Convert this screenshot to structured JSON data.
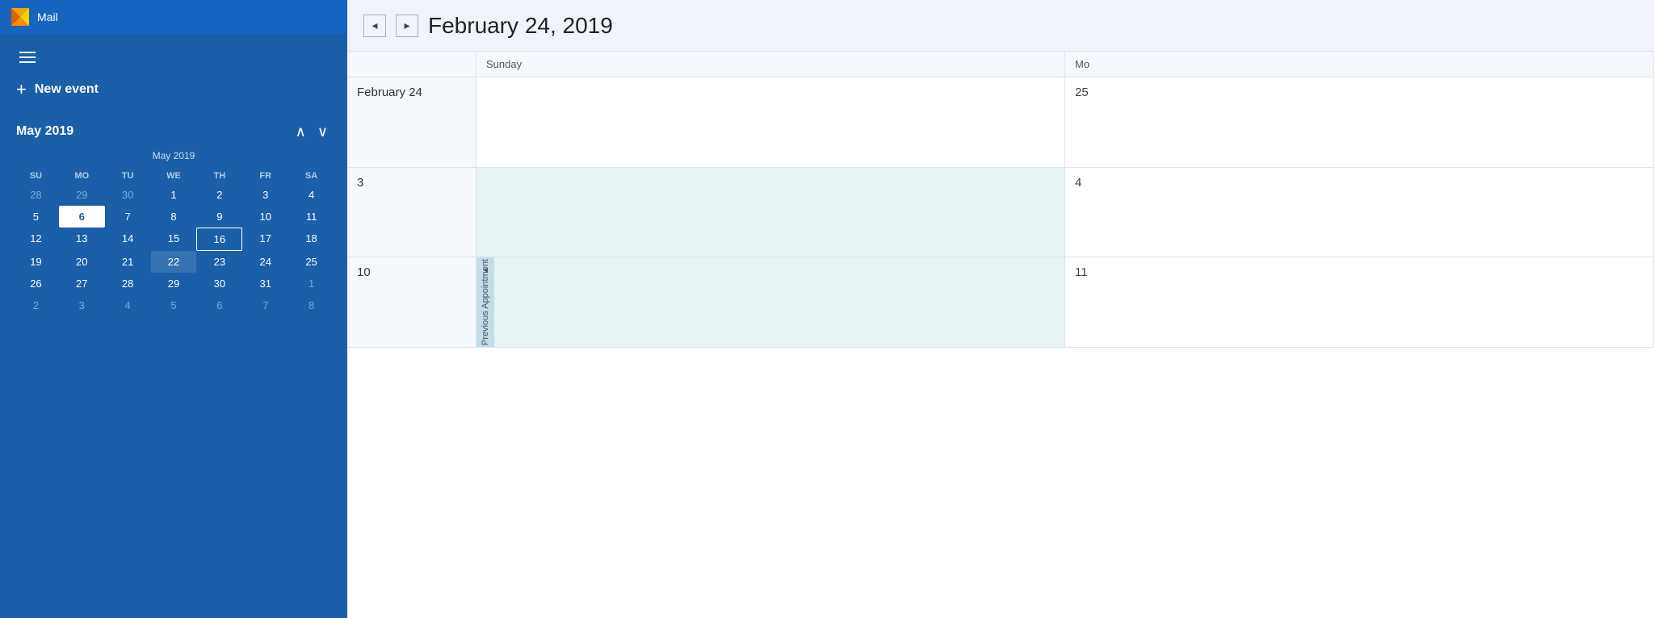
{
  "app": {
    "title": "Mail",
    "icon": "mail-icon"
  },
  "sidebar": {
    "hamburger_label": "Menu",
    "new_event_label": "New event",
    "month_nav": {
      "label": "May 2019",
      "prev_label": "Previous month",
      "next_label": "Next month"
    },
    "mini_calendar": {
      "header": "May 2019",
      "dow": [
        "SU",
        "MO",
        "TU",
        "WE",
        "TH",
        "FR",
        "SA"
      ],
      "weeks": [
        [
          {
            "day": "28",
            "other": true
          },
          {
            "day": "29",
            "other": true
          },
          {
            "day": "30",
            "other": true
          },
          {
            "day": "1",
            "other": false
          },
          {
            "day": "2",
            "other": false
          },
          {
            "day": "3",
            "other": false
          },
          {
            "day": "4",
            "other": false
          }
        ],
        [
          {
            "day": "5",
            "other": false
          },
          {
            "day": "6",
            "other": false,
            "today": true
          },
          {
            "day": "7",
            "other": false
          },
          {
            "day": "8",
            "other": false
          },
          {
            "day": "9",
            "other": false
          },
          {
            "day": "10",
            "other": false
          },
          {
            "day": "11",
            "other": false
          }
        ],
        [
          {
            "day": "12",
            "other": false
          },
          {
            "day": "13",
            "other": false
          },
          {
            "day": "14",
            "other": false
          },
          {
            "day": "15",
            "other": false
          },
          {
            "day": "16",
            "other": false,
            "selected": true
          },
          {
            "day": "17",
            "other": false
          },
          {
            "day": "18",
            "other": false
          }
        ],
        [
          {
            "day": "19",
            "other": false
          },
          {
            "day": "20",
            "other": false
          },
          {
            "day": "21",
            "other": false
          },
          {
            "day": "22",
            "other": false,
            "hover": true
          },
          {
            "day": "23",
            "other": false
          },
          {
            "day": "24",
            "other": false
          },
          {
            "day": "25",
            "other": false
          }
        ],
        [
          {
            "day": "26",
            "other": false
          },
          {
            "day": "27",
            "other": false
          },
          {
            "day": "28",
            "other": false
          },
          {
            "day": "29",
            "other": false
          },
          {
            "day": "30",
            "other": false
          },
          {
            "day": "31",
            "other": false
          },
          {
            "day": "1",
            "other": true
          }
        ],
        [
          {
            "day": "2",
            "other": true
          },
          {
            "day": "3",
            "other": true
          },
          {
            "day": "4",
            "other": true
          },
          {
            "day": "5",
            "other": true
          },
          {
            "day": "6",
            "other": true
          },
          {
            "day": "7",
            "other": true
          },
          {
            "day": "8",
            "other": true
          }
        ]
      ]
    }
  },
  "calendar": {
    "title": "February 24, 2019",
    "prev_label": "◂",
    "next_label": "▸",
    "week_days": [
      "Sunday",
      "Mo"
    ],
    "weeks": [
      {
        "range_label": "February 24",
        "cells": [
          {
            "day": "",
            "shaded": false
          },
          {
            "day": "25",
            "shaded": false
          }
        ]
      },
      {
        "range_label": "3",
        "cells": [
          {
            "day": "",
            "shaded": true
          },
          {
            "day": "4",
            "shaded": false
          }
        ]
      },
      {
        "range_label": "10",
        "cells": [
          {
            "day": "",
            "shaded": true,
            "has_side_tab": true
          },
          {
            "day": "11",
            "shaded": false
          }
        ]
      }
    ],
    "side_tab_label": "Previous Appointment",
    "side_tab_arrow": "◂"
  }
}
